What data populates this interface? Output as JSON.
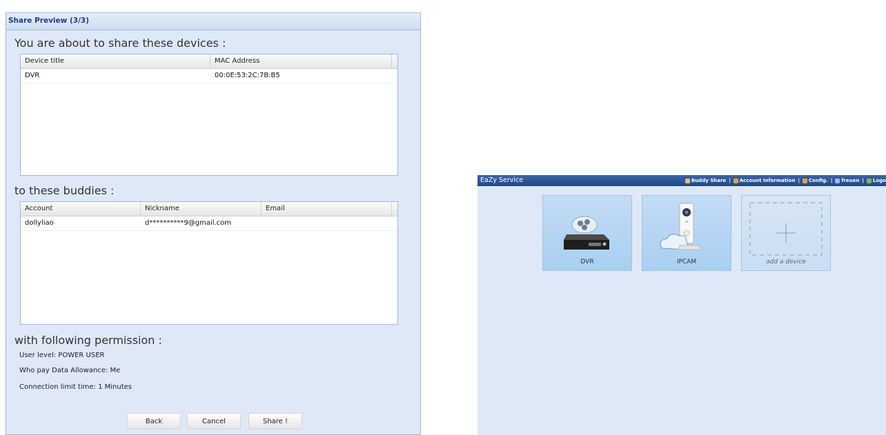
{
  "dialog": {
    "title": "Share Preview (3/3)",
    "devices_heading": "You are about to share these devices :",
    "devices_columns": [
      "Device title",
      "MAC Address"
    ],
    "devices_rows": [
      [
        "DVR",
        "00:0E:53:2C:7B:B5"
      ]
    ],
    "buddies_heading": "to these buddies :",
    "buddies_columns": [
      "Account",
      "Nickname",
      "Email"
    ],
    "buddies_rows": [
      [
        "dollyliao",
        "d**********9@gmail.com",
        ""
      ]
    ],
    "permission_heading": "with following permission :",
    "user_level": "User level: POWER USER",
    "data_allowance": "Who pay Data Allowance: Me",
    "connection_limit": "Connection limit time: 1 Minutes",
    "back_label": "Back",
    "cancel_label": "Cancel",
    "share_label": "Share !"
  },
  "app": {
    "title": "EaZy Service",
    "menu": {
      "buddy_share": "Buddy Share",
      "account_info": "Account Information",
      "config": "Config.",
      "user": "freuen",
      "logout": "Logo"
    },
    "tiles": {
      "dvr": "DVR",
      "ipcam": "IPCAM",
      "add": "add a device"
    }
  },
  "colors": {
    "accent": "#15428b",
    "panel_bg": "#dfe8f6",
    "tile_bg": "#a8cff2",
    "bar_bg": "#1f4787"
  }
}
